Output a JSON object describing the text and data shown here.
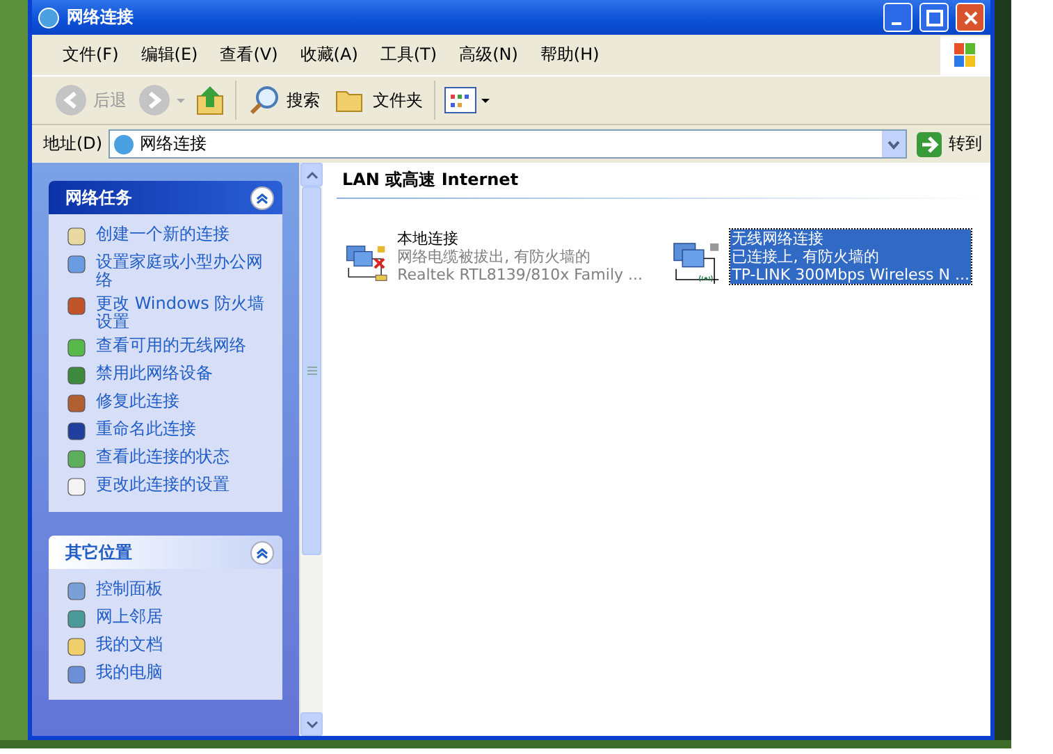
{
  "window": {
    "title": "网络连接"
  },
  "menu": [
    "文件(F)",
    "编辑(E)",
    "查看(V)",
    "收藏(A)",
    "工具(T)",
    "高级(N)",
    "帮助(H)"
  ],
  "toolbar": {
    "back": "后退",
    "search": "搜索",
    "folders": "文件夹"
  },
  "address": {
    "label": "地址(D)",
    "value": "网络连接",
    "go": "转到"
  },
  "sidebar": [
    {
      "title": "网络任务",
      "expanded": true,
      "items": [
        "创建一个新的连接",
        "设置家庭或小型办公网络",
        "更改 Windows 防火墙设置",
        "查看可用的无线网络",
        "禁用此网络设备",
        "修复此连接",
        "重命名此连接",
        "查看此连接的状态",
        "更改此连接的设置"
      ]
    },
    {
      "title": "其它位置",
      "expanded": true,
      "items": [
        "控制面板",
        "网上邻居",
        "我的文档",
        "我的电脑"
      ]
    }
  ],
  "group": {
    "title": "LAN 或高速 Internet"
  },
  "connections": [
    {
      "kind": "lan",
      "connected": false,
      "selected": false,
      "name": "本地连接",
      "status": "网络电缆被拔出, 有防火墙的",
      "device": "Realtek RTL8139/810x Family ..."
    },
    {
      "kind": "wireless",
      "connected": true,
      "selected": true,
      "name": "无线网络连接",
      "status": "已连接上, 有防火墙的",
      "device": "TP-LINK 300Mbps Wireless N ..."
    }
  ]
}
